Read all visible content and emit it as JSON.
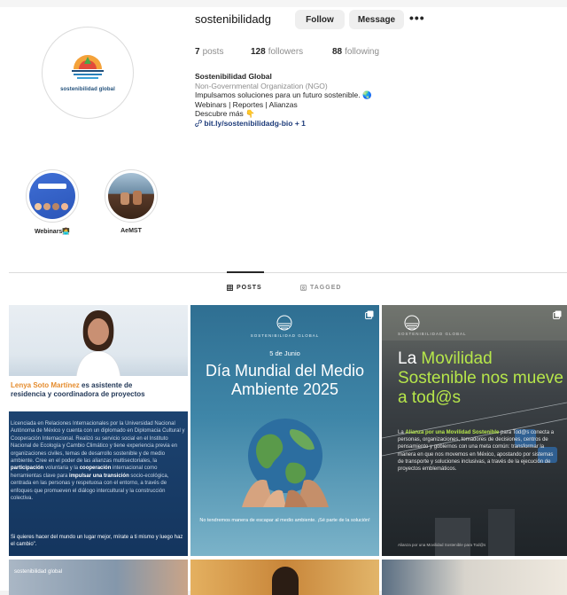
{
  "profile": {
    "username": "sostenibilidadg",
    "follow_label": "Follow",
    "message_label": "Message",
    "more_label": "•••",
    "avatar_text": "sostenibilidad global",
    "stats": {
      "posts_count": "7",
      "posts_label": "posts",
      "followers_count": "128",
      "followers_label": "followers",
      "following_count": "88",
      "following_label": "following"
    },
    "bio": {
      "name": "Sostenibilidad Global",
      "category": "Non-Governmental Organization (NGO)",
      "line1": "Impulsamos soluciones para un futuro sostenible. 🌏",
      "line2": "Webinars | Reportes | Alianzas",
      "line3": "Descubre más 👇",
      "link": "bit.ly/sostenibilidadg-bio + 1"
    }
  },
  "highlights": [
    {
      "label": "Webinars👩‍💻"
    },
    {
      "label": "AeMST"
    }
  ],
  "tabs": [
    {
      "label": "POSTS",
      "active": true
    },
    {
      "label": "TAGGED",
      "active": false
    }
  ],
  "posts": {
    "p1": {
      "caption_name": "Lenya Soto Martínez",
      "caption_rest": " es asistente de",
      "caption_line2": "residencia y coordinadora de proyectos",
      "body_a": "Licenciada en Relaciones Internacionales por la Universidad Nacional Autónoma de México y cuenta con un diplomado en Diplomacia Cultural y Cooperación Internacional. Realizó su servicio social en el Instituto Nacional de Ecología y Cambio Climático y tiene experiencia previa en organizaciones civiles, temas de desarrollo sostenible y de medio ambiente. Cree en el poder de las alianzas multisectoriales, la ",
      "body_emph1": "participación",
      "body_b": " voluntaria y la ",
      "body_emph2": "cooperación",
      "body_c": " internacional como herramientas clave para ",
      "body_emph3": "impulsar una transición",
      "body_d": " socio-ecológica, centrada en las personas y respetuosa con el entorno, a través de enfoques que promueven el diálogo intercultural y la construcción colectiva.",
      "quote": "Si quieres hacer del mundo un lugar mejor, mírate a ti mismo y luego haz el cambio\"."
    },
    "p2": {
      "org": "SOSTENIBILIDAD GLOBAL",
      "date": "5 de Junio",
      "title": "Día Mundial del Medio Ambiente 2025",
      "foot": "No tendremos manera de escapar al medio ambiente. ¡Sé parte de la solución!"
    },
    "p3": {
      "org": "SOSTENIBILIDAD GLOBAL",
      "title_a": "La ",
      "title_b": "Movilidad Sostenible nos mueve a tod@s",
      "body_pre": "La ",
      "body_bold": "Alianza por una Movilidad Sostenible",
      "body_rest": " para Tod@s conecta a personas, organizaciones, tomadores de decisiones, centros de pensamiento y gobiernos con una meta común: transformar la manera en que nos movemos en México, apostando por sistemas de transporte y soluciones inclusivas, a través de la ejecución de proyectos emblemáticos.",
      "foot": "Alianza por una Movilidad Sostenible para Tod@s"
    },
    "p4": {
      "label": "sostenibilidad global"
    }
  },
  "colors": {
    "accent_green": "#b6e64a",
    "accent_orange": "#e58c2e",
    "link_blue": "#1d3b7a"
  }
}
